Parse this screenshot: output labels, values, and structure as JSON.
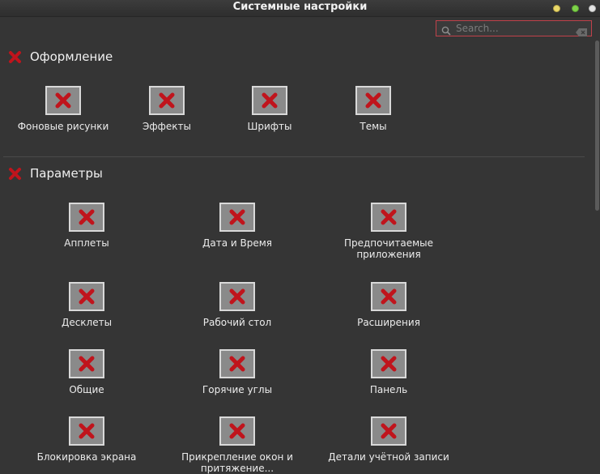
{
  "window": {
    "title": "Системные настройки",
    "buttons": [
      "minimize",
      "maximize",
      "close"
    ],
    "colors": {
      "minimize": "#e9d869",
      "maximize": "#7ed24a",
      "close": "#e4e4e4"
    }
  },
  "search": {
    "placeholder": "Search...",
    "value": ""
  },
  "sections": [
    {
      "title": "Оформление",
      "items": [
        {
          "label": "Фоновые рисунки",
          "icon": "missing-image-icon"
        },
        {
          "label": "Эффекты",
          "icon": "missing-image-icon"
        },
        {
          "label": "Шрифты",
          "icon": "missing-image-icon"
        },
        {
          "label": "Темы",
          "icon": "missing-image-icon"
        }
      ]
    },
    {
      "title": "Параметры",
      "items": [
        {
          "label": "Апплеты",
          "icon": "missing-image-icon"
        },
        {
          "label": "Дата и Время",
          "icon": "missing-image-icon"
        },
        {
          "label": "Предпочитаемые\nприложения",
          "icon": "missing-image-icon"
        },
        {
          "label": "Десклеты",
          "icon": "missing-image-icon"
        },
        {
          "label": "Рабочий стол",
          "icon": "missing-image-icon"
        },
        {
          "label": "Расширения",
          "icon": "missing-image-icon"
        },
        {
          "label": "Общие",
          "icon": "missing-image-icon"
        },
        {
          "label": "Горячие углы",
          "icon": "missing-image-icon"
        },
        {
          "label": "Панель",
          "icon": "missing-image-icon"
        },
        {
          "label": "Блокировка экрана",
          "icon": "missing-image-icon"
        },
        {
          "label": "Прикрепление окон и\nпритяжение...",
          "icon": "missing-image-icon"
        },
        {
          "label": "Детали учётной записи",
          "icon": "missing-image-icon"
        }
      ]
    }
  ],
  "colors": {
    "background": "#353535",
    "search_border": "#c0414a",
    "missing_icon": "#c0141c"
  }
}
